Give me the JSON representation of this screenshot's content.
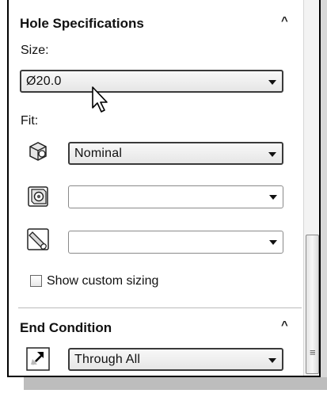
{
  "hole_specifications": {
    "title": "Hole Specifications",
    "size_label": "Size:",
    "size_value": "Ø20.0",
    "fit_label": "Fit:",
    "fit_value": "Nominal",
    "combo2_value": "",
    "combo3_value": "",
    "checkbox_label": "Show custom sizing",
    "checkbox_checked": false
  },
  "end_condition": {
    "title": "End Condition",
    "value": "Through All"
  },
  "icons": {
    "collapse": "chevron-up-icon",
    "fit": "fit-cube-icon",
    "hole_face": "hole-face-icon",
    "cylinder": "cylinder-icon",
    "direction": "reverse-direction-icon",
    "cursor": "mouse-pointer-icon"
  }
}
